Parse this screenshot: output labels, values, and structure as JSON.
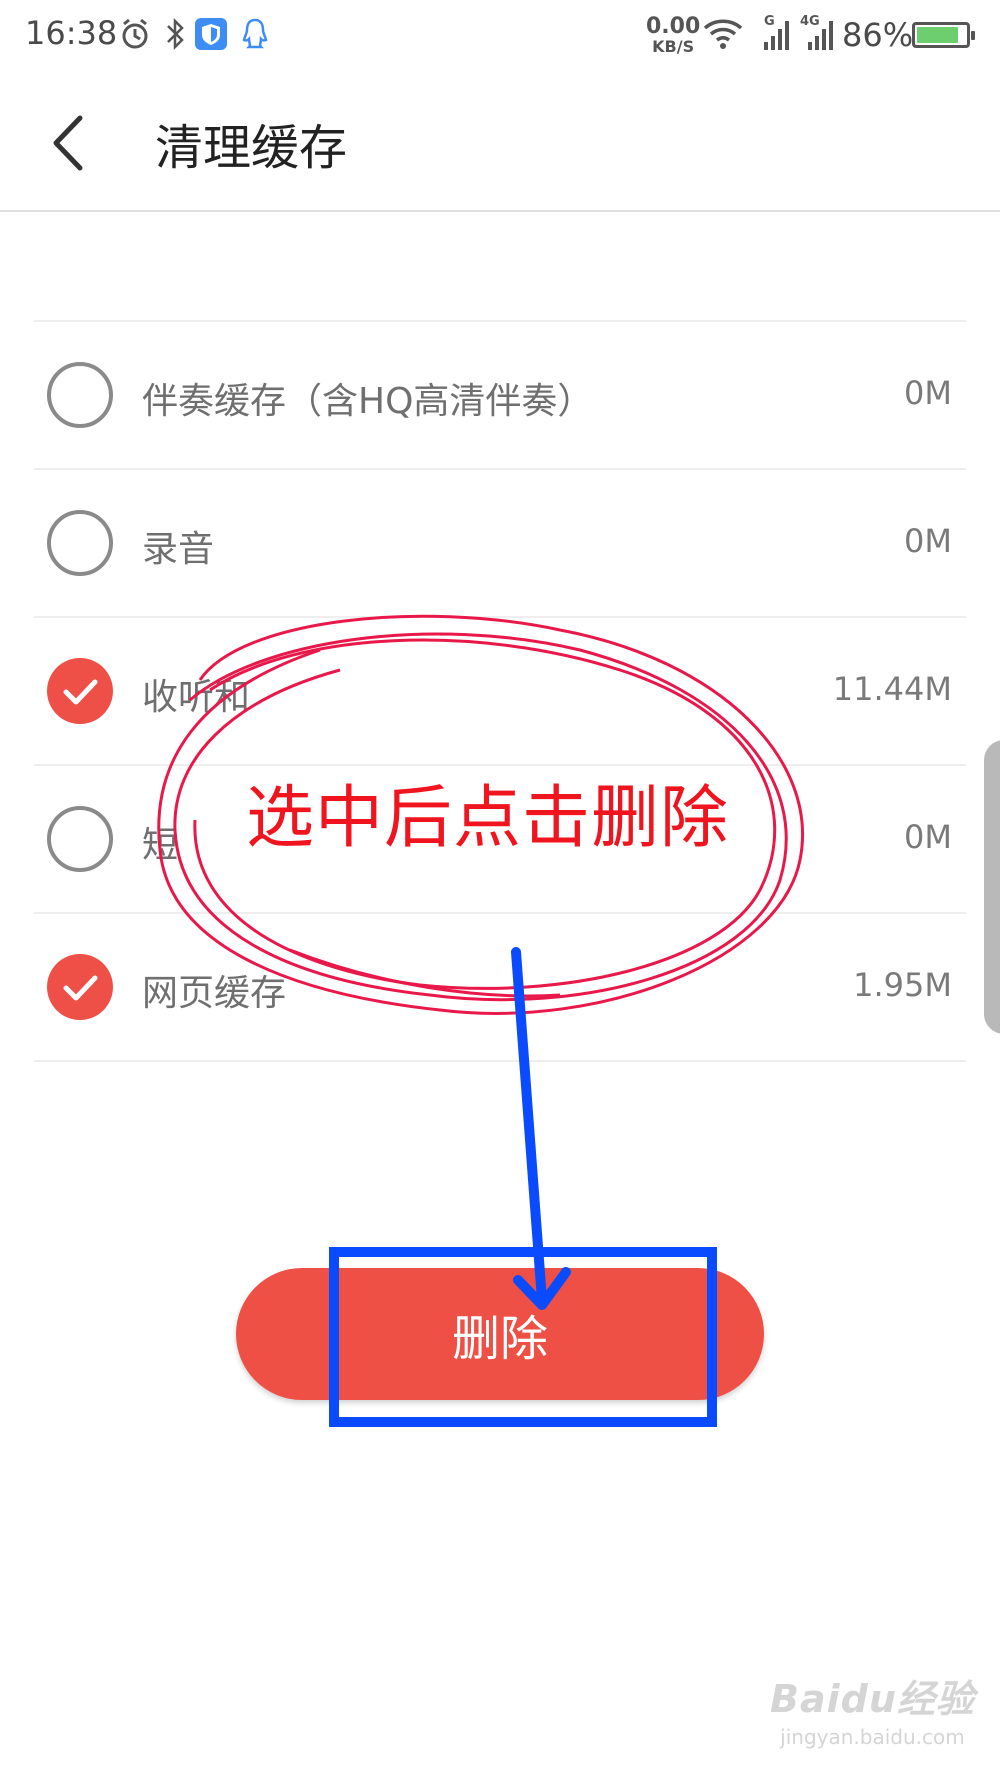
{
  "status_bar": {
    "time": "16:38",
    "net_speed_value": "0.00",
    "net_speed_unit": "KB/S",
    "battery_text": "86%",
    "battery_level": 0.86,
    "signal_1_label": "G",
    "signal_2_label": "4G",
    "icons": [
      "alarm-icon",
      "bluetooth-icon",
      "shield-app-icon",
      "qq-icon",
      "wifi-icon",
      "signal-icon",
      "battery-icon"
    ]
  },
  "header": {
    "title": "清理缓存"
  },
  "cache_list": [
    {
      "label": "伴奏缓存（含HQ高清伴奏）",
      "size": "0M",
      "checked": false
    },
    {
      "label": "录音",
      "size": "0M",
      "checked": false
    },
    {
      "label": "收听和",
      "size": "11.44M",
      "checked": true
    },
    {
      "label": "短",
      "size": "0M",
      "checked": false
    },
    {
      "label": "网页缓存",
      "size": "1.95M",
      "checked": true
    }
  ],
  "delete_button": {
    "label": "删除"
  },
  "annotation": {
    "text": "选中后点击删除",
    "circle_color": "#e8194a",
    "text_color": "#f0141e",
    "box_color": "#0a4bff"
  },
  "watermark": {
    "brand": "Baidu经验",
    "url": "jingyan.baidu.com"
  },
  "colors": {
    "accent": "#ef5046",
    "radio_unchecked": "#8a8a8a"
  }
}
